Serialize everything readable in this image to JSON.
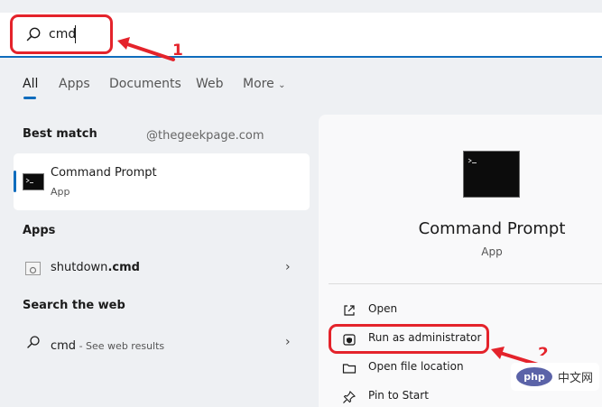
{
  "search": {
    "value": "cmd"
  },
  "tabs": [
    {
      "label": "All",
      "active": true
    },
    {
      "label": "Apps"
    },
    {
      "label": "Documents"
    },
    {
      "label": "Web"
    },
    {
      "label": "More"
    }
  ],
  "watermark": "@thegeekpage.com",
  "best_match": {
    "heading": "Best match",
    "title": "Command Prompt",
    "subtitle": "App"
  },
  "apps": {
    "heading": "Apps",
    "item_prefix": "shutdown",
    "item_bold": ".cmd"
  },
  "web": {
    "heading": "Search the web",
    "query": "cmd",
    "hint": " - See web results"
  },
  "detail": {
    "title": "Command Prompt",
    "subtitle": "App",
    "actions": [
      {
        "label": "Open",
        "icon": "open-external-icon"
      },
      {
        "label": "Run as administrator",
        "icon": "shield-icon"
      },
      {
        "label": "Open file location",
        "icon": "folder-icon"
      },
      {
        "label": "Pin to Start",
        "icon": "pin-icon"
      }
    ]
  },
  "annotations": {
    "step1": "1",
    "step2": "2"
  },
  "logo": {
    "badge": "php",
    "text": "中文网"
  },
  "colors": {
    "accent": "#0f6cbd",
    "annotation": "#e4232b"
  }
}
